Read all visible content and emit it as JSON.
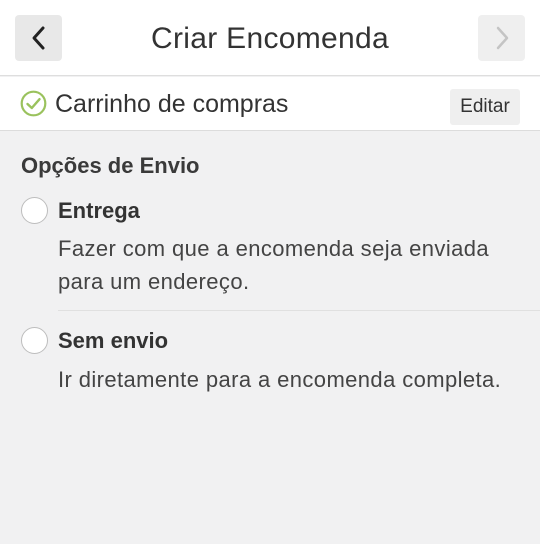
{
  "header": {
    "title": "Criar Encomenda",
    "back_icon": "chevron-left-icon",
    "forward_icon": "chevron-right-icon"
  },
  "cart": {
    "label": "Carrinho de compras",
    "status_icon": "check-circle-icon",
    "edit_label": "Editar",
    "accent_color": "#9ac25d"
  },
  "shipping": {
    "section_title": "Opções de Envio",
    "options": [
      {
        "label": "Entrega",
        "description": "Fazer com que a encomenda seja enviada para um endereço.",
        "selected": false
      },
      {
        "label": "Sem envio",
        "description": "Ir diretamente para a encomenda completa.",
        "selected": false
      }
    ]
  }
}
